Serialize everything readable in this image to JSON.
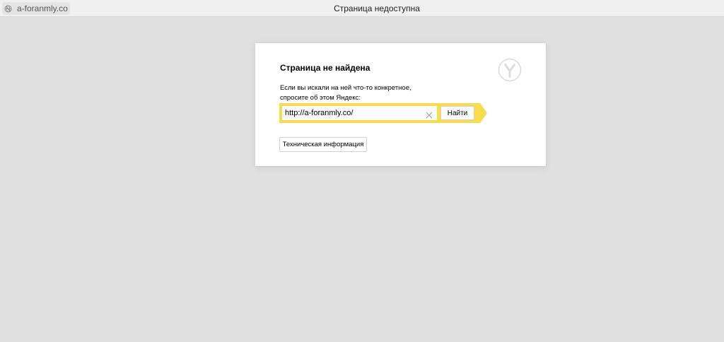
{
  "topbar": {
    "address": "a-foranmly.co",
    "page_title": "Страница недоступна",
    "site_icon": "globe-off-icon"
  },
  "card": {
    "title": "Страница не найдена",
    "description_line1": "Если вы искали на ней что-то конкретное,",
    "description_line2": "спросите об этом Яндекс:",
    "logo_icon": "yandex-browser-logo-icon",
    "search_value": "http://a-foranmly.co/",
    "search_button": "Найти",
    "clear_icon": "close-icon",
    "tech_button": "Техническая информация"
  },
  "colors": {
    "accent_yellow": "#f9dc4a",
    "page_background": "#e0e0e0",
    "card_background": "#ffffff"
  }
}
